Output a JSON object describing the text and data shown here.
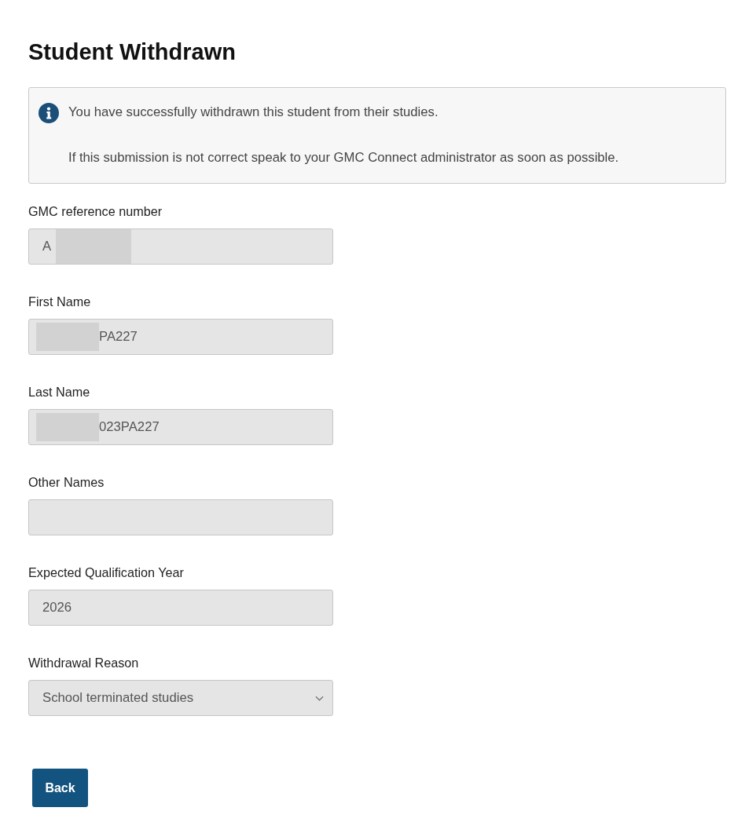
{
  "page": {
    "title": "Student Withdrawn"
  },
  "notice": {
    "kind": "info",
    "messages": [
      "You have successfully withdrawn this student from their studies.",
      "If this submission is not correct speak to your GMC Connect administrator as soon as possible."
    ]
  },
  "fields": [
    {
      "kind": "text",
      "label": "GMC reference number",
      "value": "A",
      "redacted_before": false,
      "redacted_after": true,
      "disabled": true
    },
    {
      "kind": "text",
      "label": "First Name",
      "value": "PA227",
      "redacted_before": true,
      "redacted_after": false,
      "disabled": true
    },
    {
      "kind": "text",
      "label": "Last Name",
      "value": "023PA227",
      "redacted_before": true,
      "redacted_after": false,
      "disabled": true
    },
    {
      "kind": "text",
      "label": "Other Names",
      "redacted_before": false,
      "redacted_after": false,
      "disabled": true
    },
    {
      "kind": "text",
      "label": "Expected Qualification Year",
      "value": "2026",
      "redacted_before": false,
      "redacted_after": false,
      "disabled": true
    },
    {
      "kind": "select",
      "label": "Withdrawal Reason",
      "value": "School terminated studies",
      "redacted_before": false,
      "redacted_after": false,
      "disabled": true
    }
  ],
  "buttons": [
    {
      "label": "Back"
    }
  ]
}
